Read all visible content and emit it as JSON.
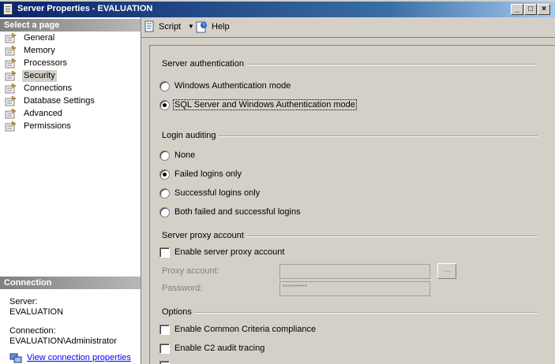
{
  "window": {
    "title": "Server Properties - EVALUATION"
  },
  "select_page": {
    "header": "Select a page",
    "items": [
      "General",
      "Memory",
      "Processors",
      "Security",
      "Connections",
      "Database Settings",
      "Advanced",
      "Permissions"
    ],
    "selected": "Security"
  },
  "connection": {
    "header": "Connection",
    "server_label": "Server:",
    "server_value": "EVALUATION",
    "connection_label": "Connection:",
    "connection_value": "EVALUATION\\Administrator",
    "view_link": "View connection properties"
  },
  "toolbar": {
    "script_label": "Script",
    "help_label": "Help"
  },
  "server_authentication": {
    "title": "Server authentication",
    "options": [
      "Windows Authentication mode",
      "SQL Server and Windows Authentication mode"
    ],
    "selected_index": 1
  },
  "login_auditing": {
    "title": "Login auditing",
    "options": [
      "None",
      "Failed logins only",
      "Successful logins only",
      "Both failed and successful logins"
    ],
    "selected_index": 1
  },
  "server_proxy": {
    "title": "Server proxy account",
    "enable_label": "Enable server proxy account",
    "proxy_account_label": "Proxy account:",
    "password_label": "Password:",
    "password_value": "**********",
    "ellipsis_label": "..."
  },
  "options": {
    "title": "Options",
    "common_criteria_label": "Enable Common Criteria compliance",
    "c2_audit_label": "Enable C2 audit tracing"
  }
}
